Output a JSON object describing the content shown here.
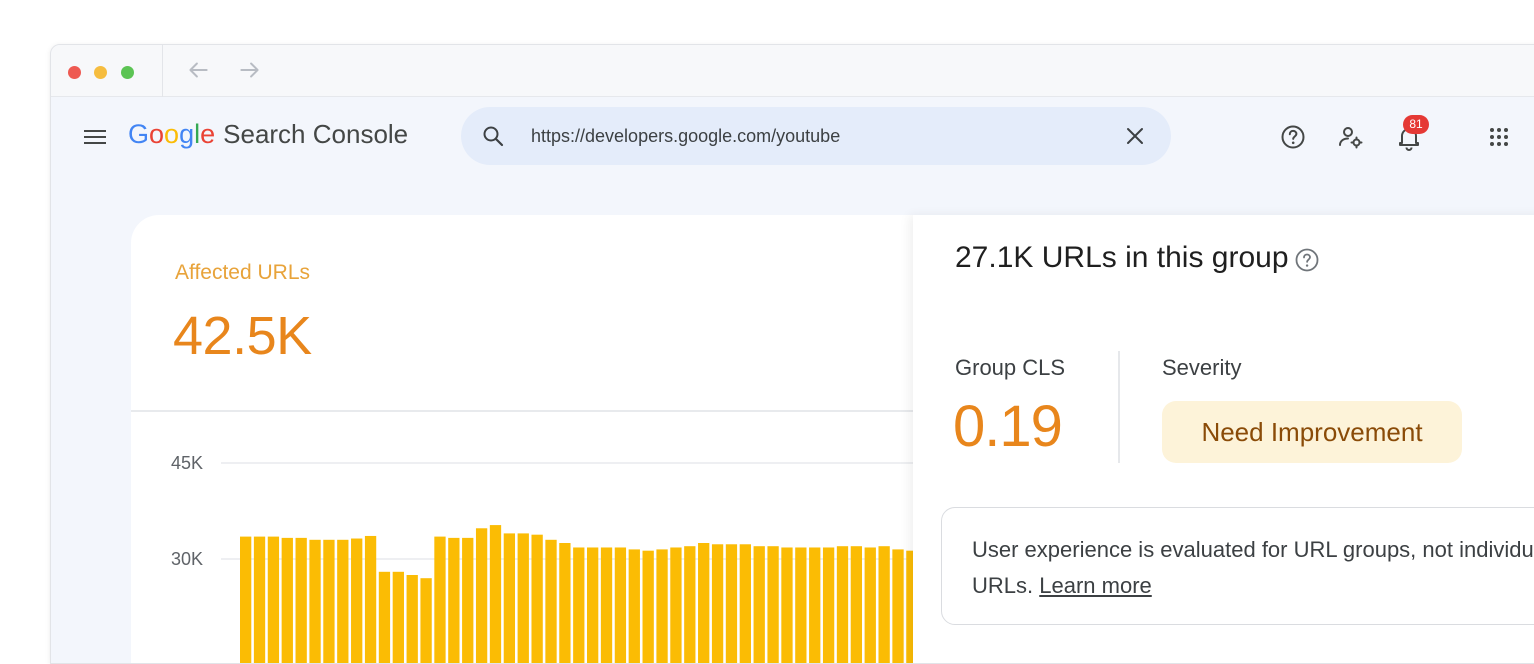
{
  "browser": {
    "nav": {
      "back_icon": "arrow-left-icon",
      "forward_icon": "arrow-right-icon"
    }
  },
  "app": {
    "logo_letters": [
      {
        "ch": "G",
        "color": "#4285F4"
      },
      {
        "ch": "o",
        "color": "#EA4335"
      },
      {
        "ch": "o",
        "color": "#FBBC05"
      },
      {
        "ch": "g",
        "color": "#4285F4"
      },
      {
        "ch": "l",
        "color": "#34A853"
      },
      {
        "ch": "e",
        "color": "#EA4335"
      }
    ],
    "product_name": "Search Console",
    "search": {
      "value": "https://developers.google.com/youtube"
    },
    "notifications_count": "81"
  },
  "summary": {
    "label": "Affected URLs",
    "value": "42.5K"
  },
  "chart_data": {
    "type": "bar",
    "yticks": [
      "45K",
      "30K"
    ],
    "ylim": [
      0,
      45000
    ],
    "color": "#FBBC04",
    "values": [
      33500,
      33500,
      33500,
      33300,
      33300,
      33000,
      33000,
      33000,
      33200,
      33600,
      28000,
      28000,
      27500,
      27000,
      33500,
      33300,
      33300,
      34800,
      35300,
      34000,
      34000,
      33800,
      33000,
      32500,
      31800,
      31800,
      31800,
      31800,
      31500,
      31300,
      31500,
      31800,
      32000,
      32500,
      32300,
      32300,
      32300,
      32000,
      32000,
      31800,
      31800,
      31800,
      31800,
      32000,
      32000,
      31800,
      32000,
      31500,
      31300,
      31300,
      31500
    ]
  },
  "panel": {
    "title": "27.1K URLs in this group",
    "cls_label": "Group CLS",
    "cls_value": "0.19",
    "severity_label": "Severity",
    "severity_value": "Need Improvement",
    "info_text": "User experience is evaluated for URL groups, not individual URLs.",
    "info_link": "Learn more"
  },
  "colors": {
    "accent_orange": "#E8861C",
    "chip_bg": "#FDF3D9",
    "chip_text": "#8A4B08"
  }
}
